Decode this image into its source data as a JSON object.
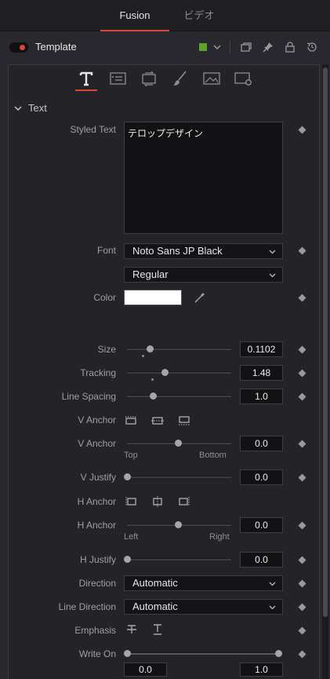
{
  "tabs": [
    {
      "label": "Fusion",
      "active": true
    },
    {
      "label": "ビデオ",
      "active": false
    }
  ],
  "header": {
    "tool_name": "Template",
    "node_color": "#5ca329"
  },
  "section_title": "Text",
  "fields": {
    "styled_text": {
      "label": "Styled Text",
      "value": "テロップデザイン"
    },
    "font": {
      "label": "Font",
      "value": "Noto Sans JP Black"
    },
    "font_style": {
      "value": "Regular"
    },
    "color": {
      "label": "Color",
      "value": "#ffffff"
    },
    "size": {
      "label": "Size",
      "value": "0.1102"
    },
    "tracking": {
      "label": "Tracking",
      "value": "1.48"
    },
    "line_spacing": {
      "label": "Line Spacing",
      "value": "1.0"
    },
    "v_anchor_buttons": {
      "label": "V Anchor"
    },
    "v_anchor": {
      "label": "V Anchor",
      "value": "0.0",
      "min_label": "Top",
      "max_label": "Bottom"
    },
    "v_justify": {
      "label": "V Justify",
      "value": "0.0"
    },
    "h_anchor_buttons": {
      "label": "H Anchor"
    },
    "h_anchor": {
      "label": "H Anchor",
      "value": "0.0",
      "min_label": "Left",
      "max_label": "Right"
    },
    "h_justify": {
      "label": "H Justify",
      "value": "0.0"
    },
    "direction": {
      "label": "Direction",
      "value": "Automatic"
    },
    "line_direction": {
      "label": "Line Direction",
      "value": "Automatic"
    },
    "emphasis": {
      "label": "Emphasis"
    },
    "write_on": {
      "label": "Write On",
      "start": "0.0",
      "end": "1.0"
    }
  }
}
